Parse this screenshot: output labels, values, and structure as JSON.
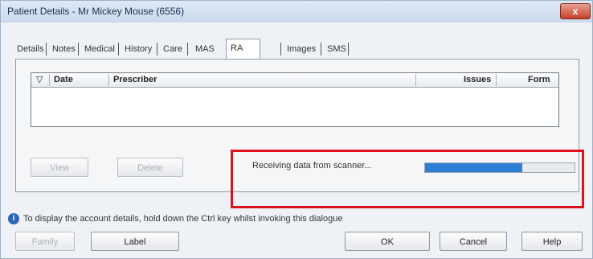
{
  "window": {
    "title": "Patient Details - Mr Mickey Mouse (6556)",
    "close_glyph": "x"
  },
  "tabs": [
    {
      "label": "Details",
      "active": false
    },
    {
      "label": "Notes",
      "active": false
    },
    {
      "label": "Medical",
      "active": false
    },
    {
      "label": "History",
      "active": false
    },
    {
      "label": "Care",
      "active": false
    },
    {
      "label": "MAS",
      "active": false
    },
    {
      "label": "RA Forms",
      "active": true
    },
    {
      "label": "Images",
      "active": false
    },
    {
      "label": "SMS",
      "active": false
    }
  ],
  "grid": {
    "filter_icon": "filter-icon",
    "columns": [
      "Date",
      "Prescriber",
      "Issues",
      "Form"
    ],
    "rows": []
  },
  "buttons": {
    "view": "View",
    "delete": "Delete",
    "family": "Family",
    "label": "Label",
    "ok": "OK",
    "cancel": "Cancel",
    "help": "Help"
  },
  "status": {
    "text": "Receiving data from scanner...",
    "progress_fraction": 0.65,
    "progress_color": "#2c7fd3",
    "highlight_color": "#e0101a"
  },
  "hint": {
    "icon": "info-icon",
    "text": "To display the account details, hold down the Ctrl key whilst invoking this dialogue"
  }
}
